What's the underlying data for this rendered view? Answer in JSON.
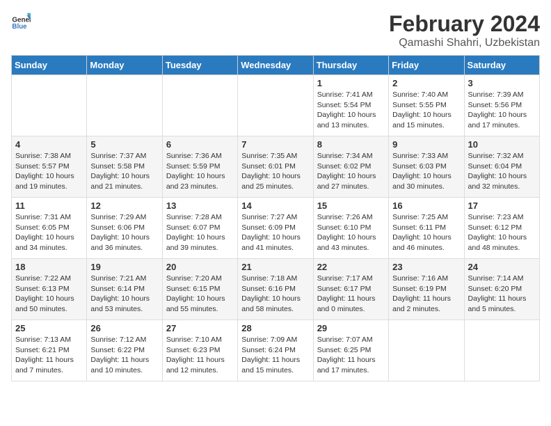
{
  "header": {
    "logo_general": "General",
    "logo_blue": "Blue",
    "main_title": "February 2024",
    "subtitle": "Qamashi Shahri, Uzbekistan"
  },
  "days_of_week": [
    "Sunday",
    "Monday",
    "Tuesday",
    "Wednesday",
    "Thursday",
    "Friday",
    "Saturday"
  ],
  "weeks": [
    [
      {
        "day": "",
        "info": ""
      },
      {
        "day": "",
        "info": ""
      },
      {
        "day": "",
        "info": ""
      },
      {
        "day": "",
        "info": ""
      },
      {
        "day": "1",
        "info": "Sunrise: 7:41 AM\nSunset: 5:54 PM\nDaylight: 10 hours\nand 13 minutes."
      },
      {
        "day": "2",
        "info": "Sunrise: 7:40 AM\nSunset: 5:55 PM\nDaylight: 10 hours\nand 15 minutes."
      },
      {
        "day": "3",
        "info": "Sunrise: 7:39 AM\nSunset: 5:56 PM\nDaylight: 10 hours\nand 17 minutes."
      }
    ],
    [
      {
        "day": "4",
        "info": "Sunrise: 7:38 AM\nSunset: 5:57 PM\nDaylight: 10 hours\nand 19 minutes."
      },
      {
        "day": "5",
        "info": "Sunrise: 7:37 AM\nSunset: 5:58 PM\nDaylight: 10 hours\nand 21 minutes."
      },
      {
        "day": "6",
        "info": "Sunrise: 7:36 AM\nSunset: 5:59 PM\nDaylight: 10 hours\nand 23 minutes."
      },
      {
        "day": "7",
        "info": "Sunrise: 7:35 AM\nSunset: 6:01 PM\nDaylight: 10 hours\nand 25 minutes."
      },
      {
        "day": "8",
        "info": "Sunrise: 7:34 AM\nSunset: 6:02 PM\nDaylight: 10 hours\nand 27 minutes."
      },
      {
        "day": "9",
        "info": "Sunrise: 7:33 AM\nSunset: 6:03 PM\nDaylight: 10 hours\nand 30 minutes."
      },
      {
        "day": "10",
        "info": "Sunrise: 7:32 AM\nSunset: 6:04 PM\nDaylight: 10 hours\nand 32 minutes."
      }
    ],
    [
      {
        "day": "11",
        "info": "Sunrise: 7:31 AM\nSunset: 6:05 PM\nDaylight: 10 hours\nand 34 minutes."
      },
      {
        "day": "12",
        "info": "Sunrise: 7:29 AM\nSunset: 6:06 PM\nDaylight: 10 hours\nand 36 minutes."
      },
      {
        "day": "13",
        "info": "Sunrise: 7:28 AM\nSunset: 6:07 PM\nDaylight: 10 hours\nand 39 minutes."
      },
      {
        "day": "14",
        "info": "Sunrise: 7:27 AM\nSunset: 6:09 PM\nDaylight: 10 hours\nand 41 minutes."
      },
      {
        "day": "15",
        "info": "Sunrise: 7:26 AM\nSunset: 6:10 PM\nDaylight: 10 hours\nand 43 minutes."
      },
      {
        "day": "16",
        "info": "Sunrise: 7:25 AM\nSunset: 6:11 PM\nDaylight: 10 hours\nand 46 minutes."
      },
      {
        "day": "17",
        "info": "Sunrise: 7:23 AM\nSunset: 6:12 PM\nDaylight: 10 hours\nand 48 minutes."
      }
    ],
    [
      {
        "day": "18",
        "info": "Sunrise: 7:22 AM\nSunset: 6:13 PM\nDaylight: 10 hours\nand 50 minutes."
      },
      {
        "day": "19",
        "info": "Sunrise: 7:21 AM\nSunset: 6:14 PM\nDaylight: 10 hours\nand 53 minutes."
      },
      {
        "day": "20",
        "info": "Sunrise: 7:20 AM\nSunset: 6:15 PM\nDaylight: 10 hours\nand 55 minutes."
      },
      {
        "day": "21",
        "info": "Sunrise: 7:18 AM\nSunset: 6:16 PM\nDaylight: 10 hours\nand 58 minutes."
      },
      {
        "day": "22",
        "info": "Sunrise: 7:17 AM\nSunset: 6:17 PM\nDaylight: 11 hours\nand 0 minutes."
      },
      {
        "day": "23",
        "info": "Sunrise: 7:16 AM\nSunset: 6:19 PM\nDaylight: 11 hours\nand 2 minutes."
      },
      {
        "day": "24",
        "info": "Sunrise: 7:14 AM\nSunset: 6:20 PM\nDaylight: 11 hours\nand 5 minutes."
      }
    ],
    [
      {
        "day": "25",
        "info": "Sunrise: 7:13 AM\nSunset: 6:21 PM\nDaylight: 11 hours\nand 7 minutes."
      },
      {
        "day": "26",
        "info": "Sunrise: 7:12 AM\nSunset: 6:22 PM\nDaylight: 11 hours\nand 10 minutes."
      },
      {
        "day": "27",
        "info": "Sunrise: 7:10 AM\nSunset: 6:23 PM\nDaylight: 11 hours\nand 12 minutes."
      },
      {
        "day": "28",
        "info": "Sunrise: 7:09 AM\nSunset: 6:24 PM\nDaylight: 11 hours\nand 15 minutes."
      },
      {
        "day": "29",
        "info": "Sunrise: 7:07 AM\nSunset: 6:25 PM\nDaylight: 11 hours\nand 17 minutes."
      },
      {
        "day": "",
        "info": ""
      },
      {
        "day": "",
        "info": ""
      }
    ]
  ]
}
